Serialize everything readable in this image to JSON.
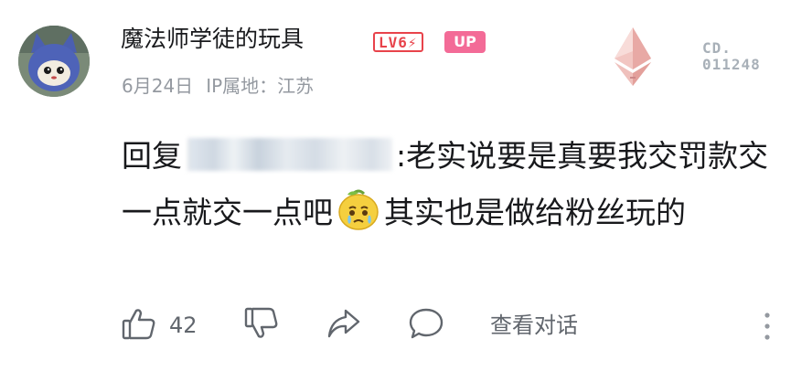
{
  "user": {
    "name": "魔法师学徒的玩具",
    "level_badge": "LV6⚡",
    "up_badge": "UP",
    "date": "6月24日",
    "ip_location": "IP属地：江苏"
  },
  "decoration": {
    "code_line1": "CD.",
    "code_line2": "011248",
    "icon": "ethereum-diamond-icon"
  },
  "comment": {
    "reply_prefix": "回复",
    "text_part1": ":老实说要是真要我交罚款交一点就交一点吧",
    "emoji": "crying-lemon-emoji",
    "text_part2": "其实也是做给粉丝玩的"
  },
  "actions": {
    "like_count": "42",
    "view_conversation": "查看对话"
  },
  "colors": {
    "level_red": "#e8434b",
    "up_pink": "#f36b97",
    "meta_gray": "#9499a0",
    "text": "#18191c"
  }
}
